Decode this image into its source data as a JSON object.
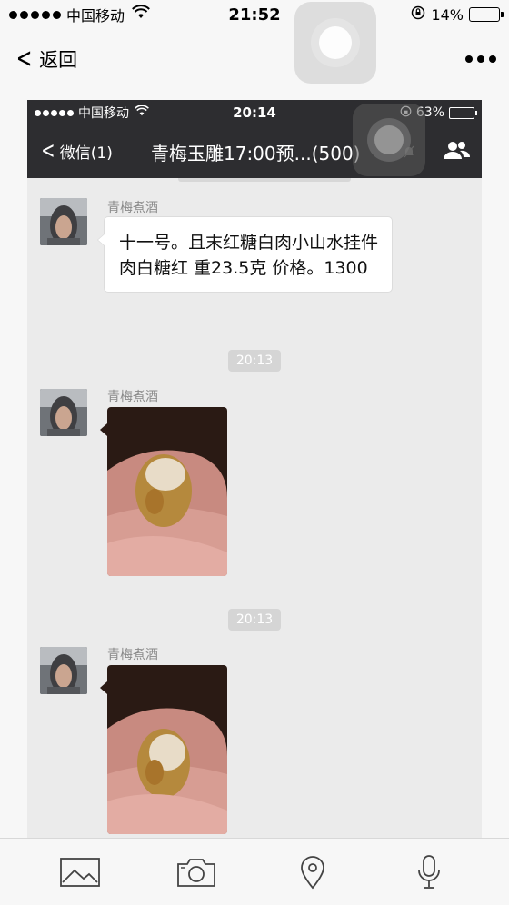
{
  "status_bar": {
    "carrier": "中国移动",
    "time": "21:52",
    "battery": "14%",
    "battery_level": 0.14
  },
  "nav": {
    "back_label": "返回",
    "more_icon": "more-dots-icon"
  },
  "inner_screen": {
    "status_bar": {
      "carrier": "中国移动",
      "time": "20:14",
      "battery": "63%",
      "battery_level": 0.63
    },
    "nav": {
      "back_label": "微信(1)",
      "title": "青梅玉雕17:00预...(500)"
    },
    "messages": [
      {
        "sender": "青梅煮酒",
        "type": "text",
        "text": "十一号。且末红糖白肉小山水挂件 肉白糖红 重23.5克 价格。1300"
      },
      {
        "type": "timestamp",
        "text": "20:13"
      },
      {
        "sender": "青梅煮酒",
        "type": "image",
        "alt_icon": "jade-pendant-photo"
      },
      {
        "type": "timestamp",
        "text": "20:13"
      },
      {
        "sender": "青梅煮酒",
        "type": "image",
        "alt_icon": "jade-pendant-photo"
      }
    ]
  },
  "toolbar": {
    "items": [
      "image-icon",
      "camera-icon",
      "location-icon",
      "microphone-icon"
    ]
  },
  "colors": {
    "inner_header": "#2d2d30",
    "chat_bg": "#ebebeb",
    "battery_low": "#e02020"
  }
}
